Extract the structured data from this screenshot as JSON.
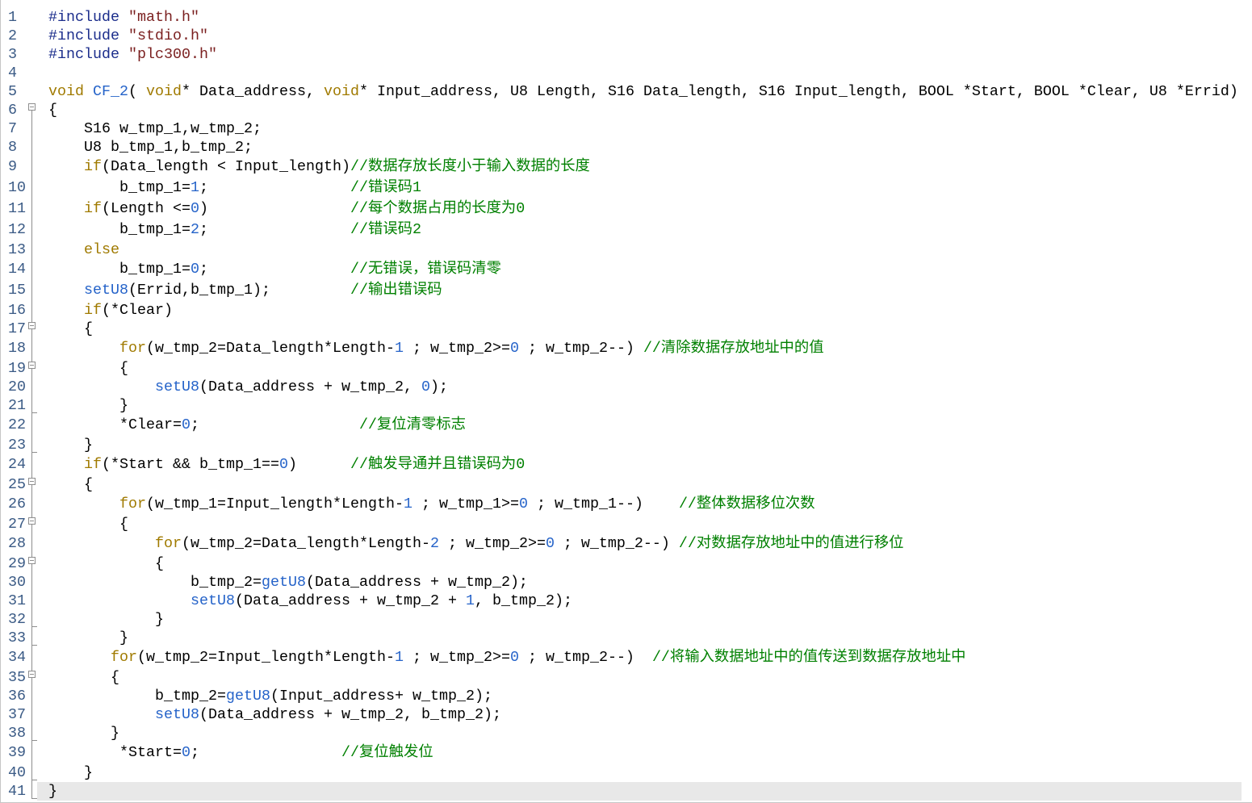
{
  "editor": {
    "theme": {
      "background": "#FFFFFF",
      "text": "#000000",
      "line_number": "#3A5A85",
      "current_line": "#E8E8E8",
      "fold_marker": "#8E8E8E"
    },
    "lines": [
      {
        "n": "1",
        "tokens": [
          {
            "t": "#include",
            "c": "#1C2E8C"
          },
          {
            "t": " \"math.h\"",
            "c": "#7A1F1F"
          }
        ]
      },
      {
        "n": "2",
        "tokens": [
          {
            "t": "#include",
            "c": "#1C2E8C"
          },
          {
            "t": " \"stdio.h\"",
            "c": "#7A1F1F"
          }
        ]
      },
      {
        "n": "3",
        "tokens": [
          {
            "t": "#include",
            "c": "#1C2E8C"
          },
          {
            "t": " \"plc300.h\"",
            "c": "#7A1F1F"
          }
        ]
      },
      {
        "n": "4",
        "tokens": []
      },
      {
        "n": "5",
        "tokens": [
          {
            "t": "void",
            "c": "#A07A00"
          },
          {
            "t": " CF_2",
            "c": "#2563C9"
          },
          {
            "t": "( "
          },
          {
            "t": "void",
            "c": "#A07A00"
          },
          {
            "t": "* Data_address, "
          },
          {
            "t": "void",
            "c": "#A07A00"
          },
          {
            "t": "* Input_address, U8 Length, S16 Data_length, S16 Input_length, BOOL *Start, BOOL *Clear, U8 *Errid)"
          }
        ]
      },
      {
        "n": "6",
        "fold_icon": "fold-collapse-icon",
        "tokens": [
          {
            "t": "{"
          }
        ]
      },
      {
        "n": "7",
        "tokens": [
          {
            "t": "    S16 w_tmp_1,w_tmp_2;"
          }
        ]
      },
      {
        "n": "8",
        "tokens": [
          {
            "t": "    U8 b_tmp_1,b_tmp_2;"
          }
        ]
      },
      {
        "n": "9",
        "tokens": [
          {
            "t": "    if",
            "c": "#A07A00"
          },
          {
            "t": "(Data_length < Input_length)"
          },
          {
            "t": "//数据存放长度小于输入数据的长度",
            "c": "#008000"
          }
        ]
      },
      {
        "n": "10",
        "tokens": [
          {
            "t": "        b_tmp_1="
          },
          {
            "t": "1",
            "c": "#2563C9"
          },
          {
            "t": ";                "
          },
          {
            "t": "//错误码1",
            "c": "#008000"
          }
        ]
      },
      {
        "n": "11",
        "tokens": [
          {
            "t": "    if",
            "c": "#A07A00"
          },
          {
            "t": "(Length <="
          },
          {
            "t": "0",
            "c": "#2563C9"
          },
          {
            "t": ")                "
          },
          {
            "t": "//每个数据占用的长度为0",
            "c": "#008000"
          }
        ]
      },
      {
        "n": "12",
        "tokens": [
          {
            "t": "        b_tmp_1="
          },
          {
            "t": "2",
            "c": "#2563C9"
          },
          {
            "t": ";                "
          },
          {
            "t": "//错误码2",
            "c": "#008000"
          }
        ]
      },
      {
        "n": "13",
        "tokens": [
          {
            "t": "    else",
            "c": "#A07A00"
          }
        ]
      },
      {
        "n": "14",
        "tokens": [
          {
            "t": "        b_tmp_1="
          },
          {
            "t": "0",
            "c": "#2563C9"
          },
          {
            "t": ";                "
          },
          {
            "t": "//无错误，错误码清零",
            "c": "#008000"
          }
        ]
      },
      {
        "n": "15",
        "tokens": [
          {
            "t": "    setU8",
            "c": "#2563C9"
          },
          {
            "t": "(Errid,b_tmp_1);         "
          },
          {
            "t": "//输出错误码",
            "c": "#008000"
          }
        ]
      },
      {
        "n": "16",
        "tokens": [
          {
            "t": "    if",
            "c": "#A07A00"
          },
          {
            "t": "(*Clear)"
          }
        ]
      },
      {
        "n": "17",
        "fold_icon": "fold-collapse-icon",
        "tokens": [
          {
            "t": "    {"
          }
        ]
      },
      {
        "n": "18",
        "tokens": [
          {
            "t": "        for",
            "c": "#A07A00"
          },
          {
            "t": "(w_tmp_2=Data_length*Length-"
          },
          {
            "t": "1",
            "c": "#2563C9"
          },
          {
            "t": " ; w_tmp_2>="
          },
          {
            "t": "0",
            "c": "#2563C9"
          },
          {
            "t": " ; w_tmp_2--) "
          },
          {
            "t": "//清除数据存放地址中的值",
            "c": "#008000"
          }
        ]
      },
      {
        "n": "19",
        "fold_icon": "fold-collapse-icon",
        "tokens": [
          {
            "t": "        {"
          }
        ]
      },
      {
        "n": "20",
        "tokens": [
          {
            "t": "            setU8",
            "c": "#2563C9"
          },
          {
            "t": "(Data_address + w_tmp_2, "
          },
          {
            "t": "0",
            "c": "#2563C9"
          },
          {
            "t": ");"
          }
        ]
      },
      {
        "n": "21",
        "fold_icon": "fold-end-icon",
        "tokens": [
          {
            "t": "        }"
          }
        ]
      },
      {
        "n": "22",
        "tokens": [
          {
            "t": "        *Clear="
          },
          {
            "t": "0",
            "c": "#2563C9"
          },
          {
            "t": ";                  "
          },
          {
            "t": "//复位清零标志",
            "c": "#008000"
          }
        ]
      },
      {
        "n": "23",
        "fold_icon": "fold-end-icon",
        "tokens": [
          {
            "t": "    }"
          }
        ]
      },
      {
        "n": "24",
        "tokens": [
          {
            "t": "    if",
            "c": "#A07A00"
          },
          {
            "t": "(*Start && b_tmp_1=="
          },
          {
            "t": "0",
            "c": "#2563C9"
          },
          {
            "t": ")      "
          },
          {
            "t": "//触发导通并且错误码为0",
            "c": "#008000"
          }
        ]
      },
      {
        "n": "25",
        "fold_icon": "fold-collapse-icon",
        "tokens": [
          {
            "t": "    {"
          }
        ]
      },
      {
        "n": "26",
        "tokens": [
          {
            "t": "        for",
            "c": "#A07A00"
          },
          {
            "t": "(w_tmp_1=Input_length*Length-"
          },
          {
            "t": "1",
            "c": "#2563C9"
          },
          {
            "t": " ; w_tmp_1>="
          },
          {
            "t": "0",
            "c": "#2563C9"
          },
          {
            "t": " ; w_tmp_1--)    "
          },
          {
            "t": "//整体数据移位次数",
            "c": "#008000"
          }
        ]
      },
      {
        "n": "27",
        "fold_icon": "fold-collapse-icon",
        "tokens": [
          {
            "t": "        {"
          }
        ]
      },
      {
        "n": "28",
        "tokens": [
          {
            "t": "            for",
            "c": "#A07A00"
          },
          {
            "t": "(w_tmp_2=Data_length*Length-"
          },
          {
            "t": "2",
            "c": "#2563C9"
          },
          {
            "t": " ; w_tmp_2>="
          },
          {
            "t": "0",
            "c": "#2563C9"
          },
          {
            "t": " ; w_tmp_2--) "
          },
          {
            "t": "//对数据存放地址中的值进行移位",
            "c": "#008000"
          }
        ]
      },
      {
        "n": "29",
        "fold_icon": "fold-collapse-icon",
        "tokens": [
          {
            "t": "            {"
          }
        ]
      },
      {
        "n": "30",
        "tokens": [
          {
            "t": "                b_tmp_2="
          },
          {
            "t": "getU8",
            "c": "#2563C9"
          },
          {
            "t": "(Data_address + w_tmp_2);"
          }
        ]
      },
      {
        "n": "31",
        "tokens": [
          {
            "t": "                setU8",
            "c": "#2563C9"
          },
          {
            "t": "(Data_address + w_tmp_2 + "
          },
          {
            "t": "1",
            "c": "#2563C9"
          },
          {
            "t": ", b_tmp_2);"
          }
        ]
      },
      {
        "n": "32",
        "fold_icon": "fold-end-icon",
        "tokens": [
          {
            "t": "            }"
          }
        ]
      },
      {
        "n": "33",
        "fold_icon": "fold-end-icon",
        "tokens": [
          {
            "t": "        }"
          }
        ]
      },
      {
        "n": "34",
        "tokens": [
          {
            "t": "       for",
            "c": "#A07A00"
          },
          {
            "t": "(w_tmp_2=Input_length*Length-"
          },
          {
            "t": "1",
            "c": "#2563C9"
          },
          {
            "t": " ; w_tmp_2>="
          },
          {
            "t": "0",
            "c": "#2563C9"
          },
          {
            "t": " ; w_tmp_2--)  "
          },
          {
            "t": "//将输入数据地址中的值传送到数据存放地址中",
            "c": "#008000"
          }
        ]
      },
      {
        "n": "35",
        "fold_icon": "fold-collapse-icon",
        "tokens": [
          {
            "t": "       {"
          }
        ]
      },
      {
        "n": "36",
        "tokens": [
          {
            "t": "            b_tmp_2="
          },
          {
            "t": "getU8",
            "c": "#2563C9"
          },
          {
            "t": "(Input_address+ w_tmp_2);"
          }
        ]
      },
      {
        "n": "37",
        "tokens": [
          {
            "t": "            setU8",
            "c": "#2563C9"
          },
          {
            "t": "(Data_address + w_tmp_2, b_tmp_2);"
          }
        ]
      },
      {
        "n": "38",
        "fold_icon": "fold-end-icon",
        "tokens": [
          {
            "t": "       }"
          }
        ]
      },
      {
        "n": "39",
        "tokens": [
          {
            "t": "        *Start="
          },
          {
            "t": "0",
            "c": "#2563C9"
          },
          {
            "t": ";                "
          },
          {
            "t": "//复位触发位",
            "c": "#008000"
          }
        ]
      },
      {
        "n": "40",
        "fold_icon": "fold-end-icon",
        "tokens": [
          {
            "t": "    }"
          }
        ]
      },
      {
        "n": "41",
        "fold_icon": "fold-end-icon",
        "current": true,
        "tokens": [
          {
            "t": "}"
          }
        ]
      }
    ]
  }
}
